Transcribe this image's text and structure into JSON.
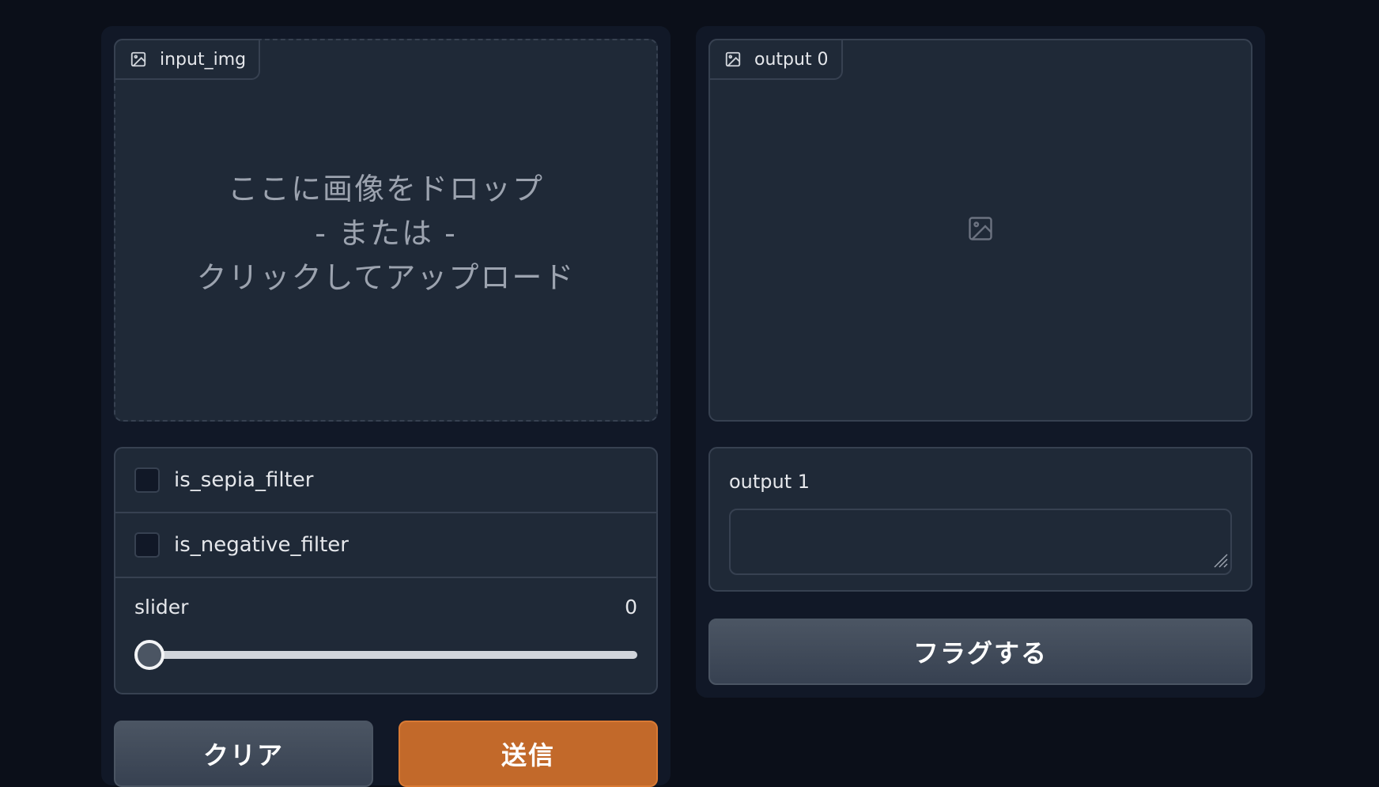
{
  "input_image": {
    "label": "input_img",
    "icon": "image-icon",
    "drop_line1": "ここに画像をドロップ",
    "drop_line2": "- または -",
    "drop_line3": "クリックしてアップロード"
  },
  "filters": {
    "sepia_label": "is_sepia_filter",
    "sepia_checked": false,
    "negative_label": "is_negative_filter",
    "negative_checked": false
  },
  "slider": {
    "label": "slider",
    "value": "0"
  },
  "buttons": {
    "clear": "クリア",
    "submit": "送信",
    "flag": "フラグする"
  },
  "output_image": {
    "label": "output 0",
    "icon": "image-icon"
  },
  "output_text": {
    "label": "output 1",
    "value": ""
  },
  "colors": {
    "background": "#0b0f19",
    "panel": "#111827",
    "block": "#1f2937",
    "border": "#374151",
    "accent": "#c2692a"
  }
}
